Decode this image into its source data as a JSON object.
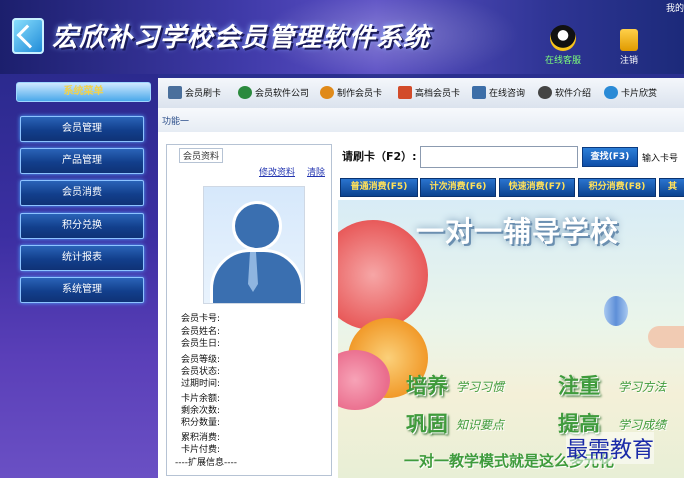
{
  "header": {
    "title": "宏欣补习学校会员管理软件系统",
    "online_service": "在线客服",
    "logout": "注销",
    "user_corner": "我的"
  },
  "sidebar": {
    "heading": "系统菜单",
    "items": [
      "会员管理",
      "产品管理",
      "会员消费",
      "积分兑换",
      "统计报表",
      "系统管理"
    ]
  },
  "toolbar": {
    "items": [
      {
        "label": "会员刷卡",
        "icon": "card-reader-icon",
        "color": "#4a6f9c"
      },
      {
        "label": "会员软件公司",
        "icon": "globe-icon",
        "color": "#2b8a3e"
      },
      {
        "label": "制作会员卡",
        "icon": "refresh-icon",
        "color": "#e08a1a"
      },
      {
        "label": "高档会员卡",
        "icon": "house-icon",
        "color": "#d24b2a"
      },
      {
        "label": "在线咨询",
        "icon": "monitor-icon",
        "color": "#3c6ea8"
      },
      {
        "label": "软件介绍",
        "icon": "gear-icon",
        "color": "#444444"
      },
      {
        "label": "卡片欣赏",
        "icon": "cloud-icon",
        "color": "#2a8ad6"
      }
    ]
  },
  "function_label": "功能一",
  "member_panel": {
    "title": "会员资料",
    "edit_link": "修改资料",
    "clear_link": "清除",
    "fields": [
      "会员卡号:",
      "会员姓名:",
      "会员生日:",
      "会员等级:",
      "会员状态:",
      "过期时间:",
      "卡片余额:",
      "剩余次数:",
      "积分数量:",
      "累积消费:",
      "卡片付费:",
      "----扩展信息----"
    ]
  },
  "swipe": {
    "label": "请刷卡（F2）:",
    "input_value": "",
    "query_button": "查找(F3)",
    "hint": "输入卡号"
  },
  "actions": [
    "普通消费(F5)",
    "计次消费(F6)",
    "快速消费(F7)",
    "积分消费(F8)",
    "其"
  ],
  "banner": {
    "title": "一对一辅导学校",
    "line1_big": "培养",
    "line1_small": "学习习惯",
    "line1_big2": "注重",
    "line1_small2": "学习方法",
    "line2_big": "巩固",
    "line2_small": "知识要点",
    "line2_big2": "提高",
    "line2_small2": "学习成绩",
    "bottom": "一对一教学模式就是这么多元化"
  },
  "watermark": "最需教育"
}
